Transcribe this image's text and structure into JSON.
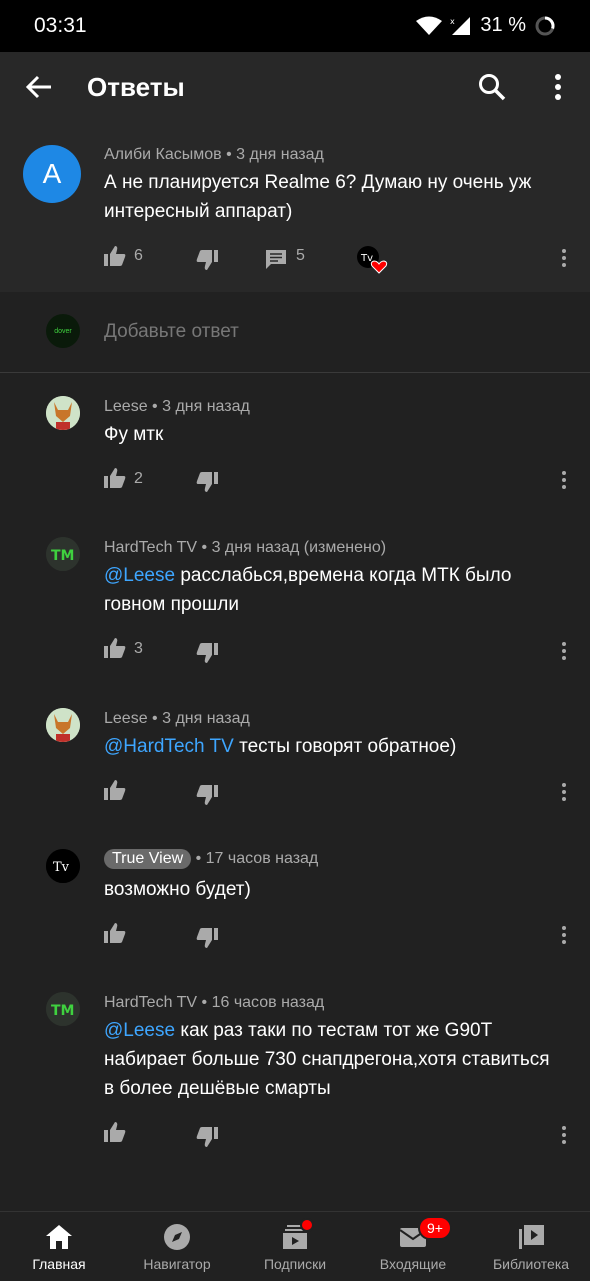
{
  "status_bar": {
    "time": "03:31",
    "battery": "31 %"
  },
  "app_bar": {
    "title": "Ответы"
  },
  "main_comment": {
    "avatar_letter": "A",
    "author": "Алиби Касымов",
    "time": "3 дня назад",
    "text": "А не планируется Realme 6? Думаю ну очень уж интересный аппарат)",
    "likes": "6",
    "replies": "5"
  },
  "add_reply": {
    "placeholder": "Добавьте ответ",
    "avatar_text": "dover"
  },
  "replies": [
    {
      "author": "Leese",
      "time": "3 дня назад",
      "mention": "",
      "text": "Фу мтк",
      "likes": "2"
    },
    {
      "author": "HardTech TV",
      "time": "3 дня назад (изменено)",
      "mention": "@Leese",
      "text": " расслабься,времена когда МТК было говном прошли",
      "likes": "3"
    },
    {
      "author": "Leese",
      "time": "3 дня назад",
      "mention": "@HardTech TV",
      "text": " тесты говорят обратное)",
      "likes": ""
    },
    {
      "author": "True View",
      "time": "17 часов назад",
      "mention": "",
      "text": "возможно будет)",
      "likes": ""
    },
    {
      "author": "HardTech TV",
      "time": "16 часов назад",
      "mention": "@Leese",
      "text": " как раз таки по тестам тот же G90T набирает больше 730 снапдрегона,хотя ставиться в более дешёвые смарты",
      "likes": ""
    }
  ],
  "nav": {
    "items": [
      {
        "label": "Главная"
      },
      {
        "label": "Навигатор"
      },
      {
        "label": "Подписки"
      },
      {
        "label": "Входящие"
      },
      {
        "label": "Библиотека"
      }
    ],
    "inbox_badge": "9+"
  },
  "colors": {
    "background": "#212121",
    "surface": "#282828",
    "accent_link": "#3ea6ff",
    "avatar_blue": "#1e88e5",
    "notification_red": "#ff0000"
  }
}
